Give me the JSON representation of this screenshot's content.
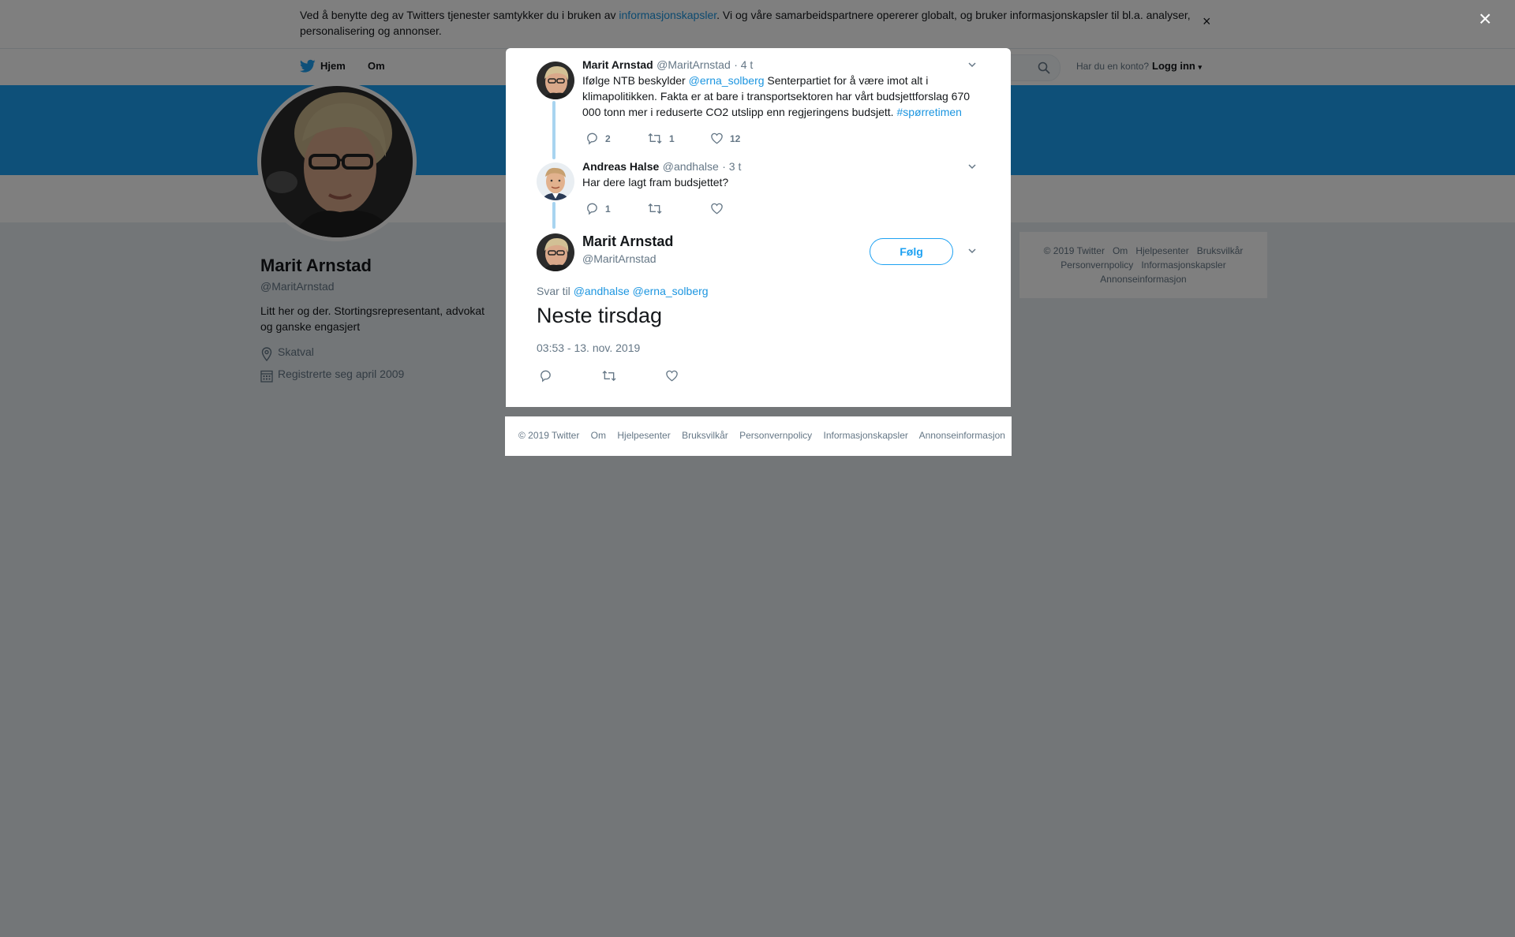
{
  "cookie": {
    "text_before": "Ved å benytte deg av Twitters tjenester samtykker du i bruken av ",
    "link": "informasjonskapsler",
    "text_after": ". Vi og våre samarbeidspartnere opererer globalt, og bruker informasjonskapsler til bl.a. analyser, personalisering og annonser.",
    "close": "×"
  },
  "nav": {
    "home": "Hjem",
    "about": "Om",
    "account_q": "Har du en konto?",
    "login": "Logg inn"
  },
  "profile": {
    "name": "Marit Arnstad",
    "handle": "@MaritArnstad",
    "bio": "Litt her og der. Stortingsrepresentant, advokat og ganske engasjert",
    "location": "Skatval",
    "joined": "Registrerte seg april 2009"
  },
  "side_footer": [
    "© 2019 Twitter",
    "Om",
    "Hjelpesenter",
    "Bruksvilkår",
    "Personvernpolicy",
    "Informasjonskapsler",
    "Annonseinformasjon"
  ],
  "overlay_close": "×",
  "tweets": [
    {
      "name": "Marit Arnstad",
      "handle": "@MaritArnstad",
      "time": "· 4 t",
      "text_1": "Ifølge NTB beskylder ",
      "mention": "@erna_solberg",
      "text_2": " Senterpartiet for å være imot alt i klimapolitikken. Fakta er at bare i transportsektoren har vårt budsjettforslag 670 000 tonn mer i reduserte CO2 utslipp enn regjeringens budsjett. ",
      "hashtag": "#spørretimen",
      "replies": "2",
      "retweets": "1",
      "likes": "12"
    },
    {
      "name": "Andreas Halse",
      "handle": "@andhalse",
      "time": "· 3 t",
      "text": "Har dere lagt fram budsjettet?",
      "replies": "1"
    }
  ],
  "main_tweet": {
    "name": "Marit Arnstad",
    "handle": "@MaritArnstad",
    "follow": "Følg",
    "reply_to": "Svar til",
    "mention1": "@andhalse",
    "mention2": "@erna_solberg",
    "text": "Neste tirsdag",
    "datetime": "03:53 - 13. nov. 2019"
  },
  "modal_footer": [
    "© 2019 Twitter",
    "Om",
    "Hjelpesenter",
    "Bruksvilkår",
    "Personvernpolicy",
    "Informasjonskapsler",
    "Annonseinformasjon"
  ],
  "colors": {
    "accent": "#1da1f2",
    "link": "#1b95e0",
    "text": "#14171a",
    "muted": "#657786",
    "thread": "#a8d4f0"
  }
}
